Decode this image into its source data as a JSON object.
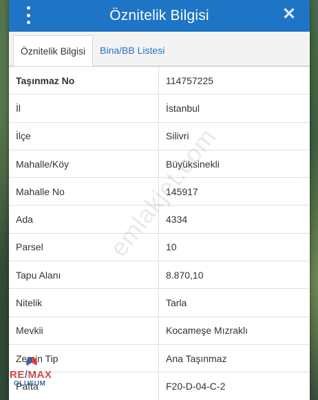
{
  "window": {
    "title": "Öznitelik Bilgisi",
    "menu_icon": "vertical-dots-icon",
    "close_icon": "close-icon"
  },
  "tabs": [
    {
      "label": "Öznitelik Bilgisi",
      "active": true
    },
    {
      "label": "Bina/BB Listesi",
      "active": false
    }
  ],
  "rows": [
    {
      "key": "Taşınmaz No",
      "value": "114757225"
    },
    {
      "key": "İl",
      "value": "İstanbul"
    },
    {
      "key": "İlçe",
      "value": "Silivri"
    },
    {
      "key": "Mahalle/Köy",
      "value": "Büyüksinekli"
    },
    {
      "key": "Mahalle No",
      "value": "145917"
    },
    {
      "key": "Ada",
      "value": "4334"
    },
    {
      "key": "Parsel",
      "value": "10"
    },
    {
      "key": "Tapu Alanı",
      "value": "8.870,10"
    },
    {
      "key": "Nitelik",
      "value": "Tarla"
    },
    {
      "key": "Mevkii",
      "value": "Kocameşe Mızraklı"
    },
    {
      "key": "Zemin Tip",
      "value": "Ana Taşınmaz"
    },
    {
      "key": "Pafta",
      "value": "F20-D-04-C-2"
    }
  ],
  "watermark": {
    "text": "emlakjet.com"
  },
  "logo": {
    "brand_left": "RE",
    "brand_slash": "/",
    "brand_right": "MAX",
    "sub": "OLUŞUM"
  },
  "colors": {
    "accent": "#1e74c5",
    "panel_bg": "#f3f3f3"
  }
}
